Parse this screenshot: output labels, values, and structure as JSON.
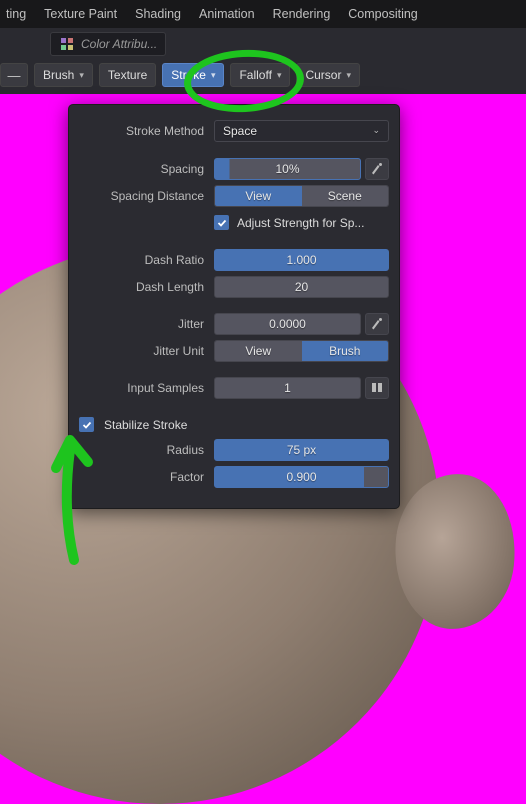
{
  "topbar": {
    "items": [
      "ting",
      "Texture Paint",
      "Shading",
      "Animation",
      "Rendering",
      "Compositing"
    ]
  },
  "header": {
    "colorAttributeLabel": "Color Attribu..."
  },
  "toolbar": {
    "dash": "—",
    "brush": "Brush",
    "texture": "Texture",
    "stroke": "Stroke",
    "falloff": "Falloff",
    "cursor": "Cursor"
  },
  "panel": {
    "strokeMethodLabel": "Stroke Method",
    "strokeMethodValue": "Space",
    "spacingLabel": "Spacing",
    "spacingValue": "10%",
    "spacingDistanceLabel": "Spacing Distance",
    "spacingDistanceA": "View",
    "spacingDistanceB": "Scene",
    "adjustStrengthLabel": "Adjust Strength for Sp...",
    "dashRatioLabel": "Dash Ratio",
    "dashRatioValue": "1.000",
    "dashLengthLabel": "Dash Length",
    "dashLengthValue": "20",
    "jitterLabel": "Jitter",
    "jitterValue": "0.0000",
    "jitterUnitLabel": "Jitter Unit",
    "jitterUnitA": "View",
    "jitterUnitB": "Brush",
    "inputSamplesLabel": "Input Samples",
    "inputSamplesValue": "1",
    "stabilizeStrokeLabel": "Stabilize Stroke",
    "radiusLabel": "Radius",
    "radiusValue": "75 px",
    "factorLabel": "Factor",
    "factorValue": "0.900"
  }
}
